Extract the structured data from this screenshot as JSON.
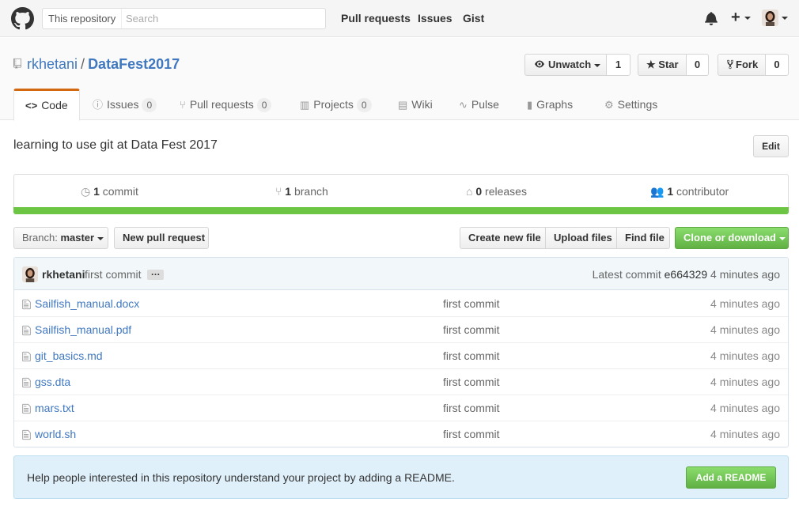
{
  "header": {
    "search_scope": "This repository",
    "search_placeholder": "Search",
    "nav": [
      "Pull requests",
      "Issues",
      "Gist"
    ],
    "plus": "+"
  },
  "repo": {
    "owner": "rkhetani",
    "separator": "/",
    "name": "DataFest2017",
    "watch_label": "Unwatch",
    "watch_count": "1",
    "star_label": "Star",
    "star_count": "0",
    "fork_label": "Fork",
    "fork_count": "0"
  },
  "tabs": [
    {
      "label": "Code",
      "icon": "code-icon"
    },
    {
      "label": "Issues",
      "count": "0",
      "icon": "issue-icon"
    },
    {
      "label": "Pull requests",
      "count": "0",
      "icon": "pull-request-icon"
    },
    {
      "label": "Projects",
      "count": "0",
      "icon": "project-icon"
    },
    {
      "label": "Wiki",
      "icon": "book-icon"
    },
    {
      "label": "Pulse",
      "icon": "pulse-icon"
    },
    {
      "label": "Graphs",
      "icon": "graph-icon"
    },
    {
      "label": "Settings",
      "icon": "gear-icon"
    }
  ],
  "description": "learning to use git at Data Fest 2017",
  "edit_label": "Edit",
  "summary": {
    "commits_count": "1",
    "commits_label": "commit",
    "branches_count": "1",
    "branches_label": "branch",
    "releases_count": "0",
    "releases_label": "releases",
    "contributors_count": "1",
    "contributors_label": "contributor"
  },
  "toolbar": {
    "branch_prefix": "Branch:",
    "branch_name": "master",
    "new_pr": "New pull request",
    "create_file": "Create new file",
    "upload_files": "Upload files",
    "find_file": "Find file",
    "clone": "Clone or download"
  },
  "commit": {
    "author": "rkhetani",
    "message": "first commit",
    "ellipsis": "…",
    "latest_prefix": "Latest commit",
    "sha": "e664329",
    "age": "4 minutes ago"
  },
  "files": [
    {
      "name": "Sailfish_manual.docx",
      "message": "first commit",
      "age": "4 minutes ago"
    },
    {
      "name": "Sailfish_manual.pdf",
      "message": "first commit",
      "age": "4 minutes ago"
    },
    {
      "name": "git_basics.md",
      "message": "first commit",
      "age": "4 minutes ago"
    },
    {
      "name": "gss.dta",
      "message": "first commit",
      "age": "4 minutes ago"
    },
    {
      "name": "mars.txt",
      "message": "first commit",
      "age": "4 minutes ago"
    },
    {
      "name": "world.sh",
      "message": "first commit",
      "age": "4 minutes ago"
    }
  ],
  "readme": {
    "text": "Help people interested in this repository understand your project by adding a README.",
    "button": "Add a README"
  },
  "colors": {
    "link": "#4078c0",
    "tab_accent": "#d26911",
    "progress": "#6cc644",
    "green_button": "#60b044"
  }
}
